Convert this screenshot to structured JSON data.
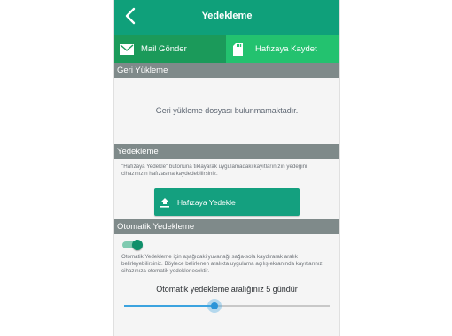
{
  "header": {
    "title": "Yedekleme"
  },
  "tabs": {
    "mail_label": "Mail Gönder",
    "save_label": "Hafızaya Kaydet"
  },
  "restore": {
    "section_title": "Geri Yükleme",
    "empty_message": "Geri yükleme dosyası bulunmamaktadır."
  },
  "backup": {
    "section_title": "Yedekleme",
    "description": "\"Hafızaya Yedekle\" butonuna tıklayarak uygulamadaki kayıtlarınızın yedeğini cihazınızın hafızasına kaydedebilirsiniz.",
    "button_label": "Hafızaya Yedekle"
  },
  "auto_backup": {
    "section_title": "Otomatik Yedekleme",
    "toggle_on": true,
    "description": "Otomatik Yedekleme için aşağıdaki yuvarlağı sağa-sola kaydırarak aralık belirleyebilirsiniz. Böylece belirlenen aralıkta uygulama açılış ekranında kayıtlarınız cihazınıza otomatik yedeklenecektir.",
    "range_label": "Otomatik yedekleme aralığınız 5 gündür",
    "slider_fraction": 0.44
  },
  "colors": {
    "appbar": "#0fa07a",
    "tab_mail": "#1b9a5a",
    "tab_save": "#23c26f",
    "section_header": "#7f8a8a",
    "button": "#14a07f",
    "slider": "#3ca3df"
  },
  "icons": {
    "back": "chevron-left-icon",
    "mail": "mail-icon",
    "save": "sd-card-icon",
    "upload": "upload-icon"
  }
}
